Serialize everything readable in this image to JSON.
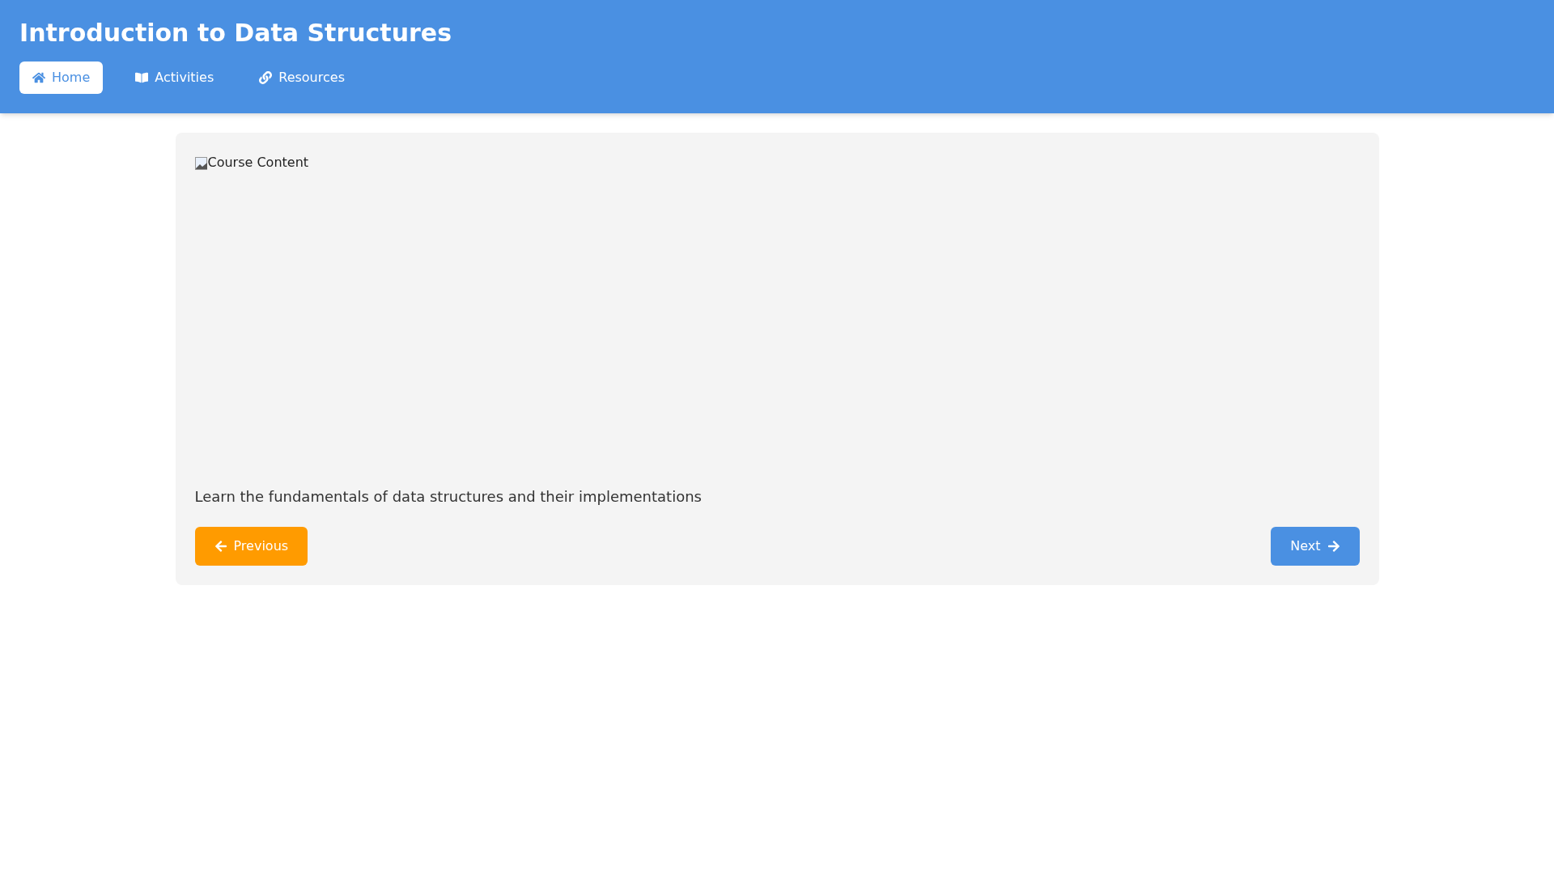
{
  "header": {
    "title": "Introduction to Data Structures"
  },
  "nav": [
    {
      "label": "Home",
      "kind": "home",
      "selected": true
    },
    {
      "label": "Activities",
      "kind": "book",
      "selected": false
    },
    {
      "label": "Resources",
      "kind": "link",
      "selected": false
    }
  ],
  "content": {
    "image_alt": "Course Content",
    "description": "Learn the fundamentals of data structures and their implementations"
  },
  "buttons": [
    {
      "label": "Previous",
      "kind": "previous"
    },
    {
      "label": "Next",
      "kind": "next"
    }
  ]
}
